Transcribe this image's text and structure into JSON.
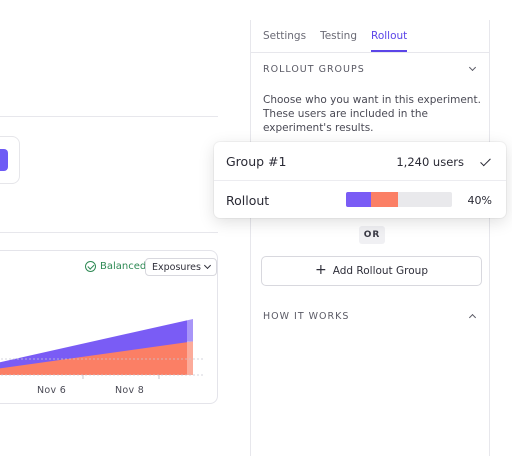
{
  "colors": {
    "accent": "#5b45e8",
    "purple": "#7a5cf5",
    "salmon": "#fb7f65",
    "balanced_green": "#2f8a55"
  },
  "background_chart": {
    "status_label": "Balanced",
    "status_icon": "check-circle-icon",
    "metric_dropdown": "Exposures",
    "x_tick_labels": [
      "Nov  6",
      "Nov  8"
    ]
  },
  "chart_data": {
    "type": "area",
    "x_ticks": [
      "Nov  6",
      "Nov  8"
    ],
    "series": [
      {
        "values": [
          2,
          10
        ],
        "color": "#7a5cf5"
      },
      {
        "values": [
          1,
          6
        ],
        "color": "#fb7f65"
      }
    ]
  },
  "panel": {
    "tabs": [
      {
        "label": "Settings",
        "active": false
      },
      {
        "label": "Testing",
        "active": false
      },
      {
        "label": "Rollout",
        "active": true
      }
    ],
    "rollout_groups_heading": "ROLLOUT GROUPS",
    "description": "Choose who you want in this experiment. These users are included in the experiment's results.",
    "or_label": "OR",
    "add_group_label": "Add Rollout Group",
    "how_it_works_heading": "HOW IT WORKS"
  },
  "group_card": {
    "title": "Group #1",
    "users": "1,240 users",
    "rollout_label": "Rollout",
    "rollout_percent": "40%",
    "rollout_split": [
      {
        "fraction": 0.24,
        "color": "#7a5cf5"
      },
      {
        "fraction": 0.25,
        "color": "#fb7f65"
      }
    ]
  }
}
